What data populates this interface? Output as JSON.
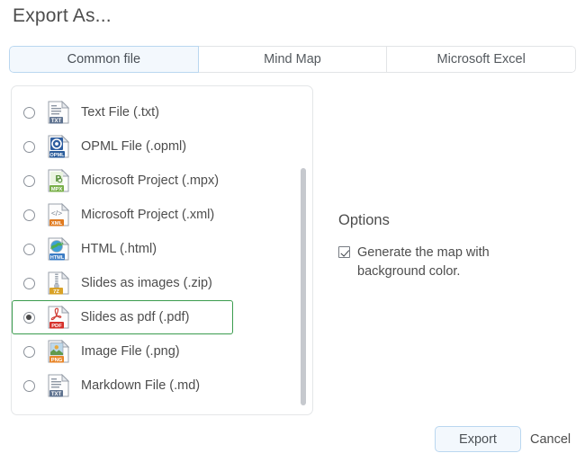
{
  "dialog": {
    "title": "Export As..."
  },
  "tabs": [
    {
      "label": "Common file",
      "active": true
    },
    {
      "label": "Mind Map",
      "active": false
    },
    {
      "label": "Microsoft Excel",
      "active": false
    }
  ],
  "file_list": {
    "items": [
      {
        "label": "Text File (.txt)",
        "icon": "txt-file-icon",
        "badge": "TXT",
        "badge_color": "#5f7390",
        "selected": false
      },
      {
        "label": "OPML File (.opml)",
        "icon": "opml-file-icon",
        "badge": "OPML",
        "badge_color": "#2a5c9b",
        "selected": false
      },
      {
        "label": "Microsoft Project (.mpx)",
        "icon": "mpx-file-icon",
        "badge": "MPX",
        "badge_color": "#7ab04a",
        "selected": false
      },
      {
        "label": "Microsoft Project (.xml)",
        "icon": "xml-file-icon",
        "badge": "XML",
        "badge_color": "#e07b20",
        "selected": false
      },
      {
        "label": "HTML (.html)",
        "icon": "html-file-icon",
        "badge": "HTML",
        "badge_color": "#3b7cc4",
        "selected": false
      },
      {
        "label": "Slides as images (.zip)",
        "icon": "zip-file-icon",
        "badge": "7Z",
        "badge_color": "#d9a227",
        "selected": false
      },
      {
        "label": "Slides as pdf (.pdf)",
        "icon": "pdf-file-icon",
        "badge": "PDF",
        "badge_color": "#d6312b",
        "selected": true
      },
      {
        "label": "Image File (.png)",
        "icon": "png-file-icon",
        "badge": "PNG",
        "badge_color": "#e8862a",
        "selected": false
      },
      {
        "label": "Markdown File (.md)",
        "icon": "markdown-file-icon",
        "badge": "TXT",
        "badge_color": "#5f7390",
        "selected": false
      }
    ],
    "selected_index": 6,
    "highlight_color": "#3b9c4e"
  },
  "options": {
    "title": "Options",
    "checkbox": {
      "label": "Generate the map with background color.",
      "checked": true
    }
  },
  "footer": {
    "export_label": "Export",
    "cancel_label": "Cancel"
  },
  "colors": {
    "accent": "#bad7f0",
    "accent_bg": "#f3f8fd",
    "selection_green": "#3b9c4e",
    "text": "#4d4d4d",
    "border": "#e4e6e8"
  }
}
